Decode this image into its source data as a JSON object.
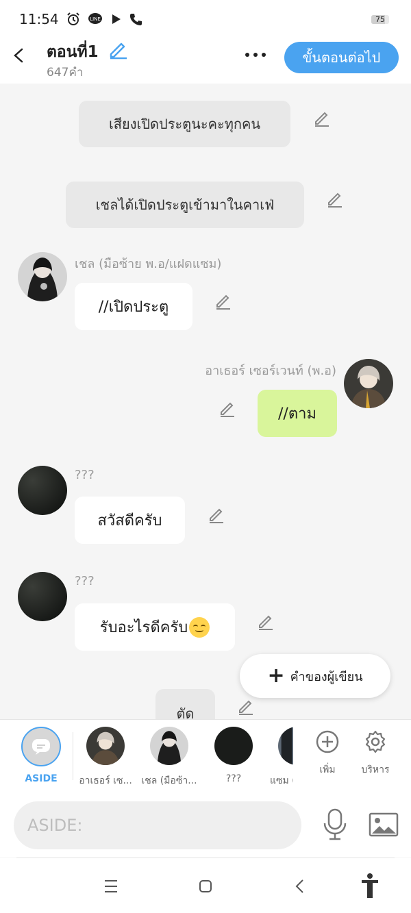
{
  "status": {
    "time": "11:54",
    "battery": "75",
    "battery_fraction": 0.75
  },
  "header": {
    "title": "ตอนที่1",
    "word_count": "647คำ",
    "next_label": "ขั้นตอนต่อไป"
  },
  "messages": {
    "narr1": "เสียงเปิดประตูนะคะทุกคน",
    "narr2": "เชลได้เปิดประตูเข้ามาในคาเฟ่",
    "m1_name": "เชล (มือซ้าย พ.อ/แฝดแซม)",
    "m1_text": "//เปิดประตู",
    "m2_name": "อาเธอร์ เซอร์เวนท์ (พ.อ)",
    "m2_text": "//ตาม",
    "m3_name": "???",
    "m3_text": "สวัสดีครับ",
    "m4_name": "???",
    "m4_text": "รับอะไรดีครับ",
    "narr3": "ตัด"
  },
  "fab_label": "คำของผู้เขียน",
  "characters": {
    "aside": "ASIDE",
    "c1": "อาเธอร์ เซ...",
    "c2": "เชล (มือซ้า...",
    "c3": "???",
    "c4": "แซม ("
  },
  "tools": {
    "add": "เพิ่ม",
    "manage": "บริหาร"
  },
  "input": {
    "placeholder": "ASIDE:"
  },
  "colors": {
    "accent": "#4aa3f0",
    "green_bubble": "#d9f59b"
  }
}
